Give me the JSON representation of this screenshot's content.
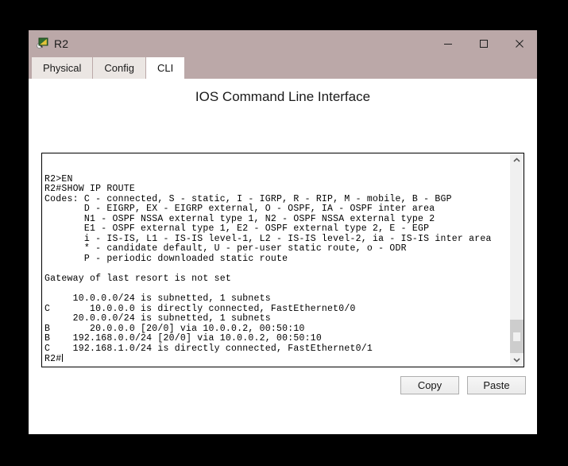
{
  "window": {
    "title": "R2",
    "icon": "packet-tracer-device-icon",
    "titlebar_color": "#bba8a8",
    "controls": {
      "minimize": "minimize-icon",
      "maximize": "maximize-icon",
      "close": "close-icon"
    }
  },
  "tabs": [
    {
      "label": "Physical",
      "active": false
    },
    {
      "label": "Config",
      "active": false
    },
    {
      "label": "CLI",
      "active": true
    }
  ],
  "panel": {
    "title": "IOS Command Line Interface"
  },
  "terminal": {
    "lines": [
      "R2>EN",
      "R2#SHOW IP ROUTE",
      "Codes: C - connected, S - static, I - IGRP, R - RIP, M - mobile, B - BGP",
      "       D - EIGRP, EX - EIGRP external, O - OSPF, IA - OSPF inter area",
      "       N1 - OSPF NSSA external type 1, N2 - OSPF NSSA external type 2",
      "       E1 - OSPF external type 1, E2 - OSPF external type 2, E - EGP",
      "       i - IS-IS, L1 - IS-IS level-1, L2 - IS-IS level-2, ia - IS-IS inter area",
      "       * - candidate default, U - per-user static route, o - ODR",
      "       P - periodic downloaded static route",
      "",
      "Gateway of last resort is not set",
      "",
      "     10.0.0.0/24 is subnetted, 1 subnets",
      "C       10.0.0.0 is directly connected, FastEthernet0/0",
      "     20.0.0.0/24 is subnetted, 1 subnets",
      "B       20.0.0.0 [20/0] via 10.0.0.2, 00:50:10",
      "B    192.168.0.0/24 [20/0] via 10.0.0.2, 00:50:10",
      "C    192.168.1.0/24 is directly connected, FastEthernet0/1",
      "R2#"
    ],
    "cursor_visible": true
  },
  "scrollbar": {
    "up_arrow": "chevron-up-icon",
    "down_arrow": "chevron-down-icon",
    "thumb_position": "near-bottom"
  },
  "actions": {
    "copy_label": "Copy",
    "paste_label": "Paste"
  }
}
